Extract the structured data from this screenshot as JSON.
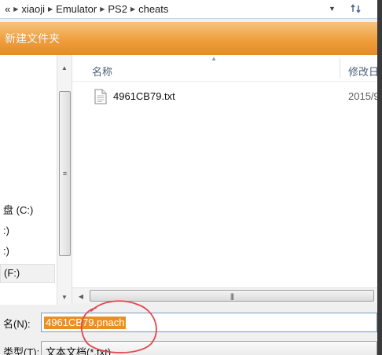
{
  "address": {
    "back_glyph": "«",
    "crumbs": [
      "xiaoji",
      "Emulator",
      "PS2",
      "cheats"
    ]
  },
  "toolbar": {
    "new_folder_label": "新建文件夹"
  },
  "nav": {
    "items": [
      "盘 (C:)",
      ":)",
      ":)",
      "(F:)"
    ]
  },
  "columns": {
    "name": "名称",
    "date_modified": "修改日"
  },
  "files": [
    {
      "name": "4961CB79.txt",
      "date": "2015/9",
      "icon": "text-file-icon"
    }
  ],
  "save": {
    "filename_label": "名(N):",
    "filename_value": "4961CB79.pnach",
    "filetype_label": "类型(T):",
    "filetype_value": "文本文档(*.txt)"
  },
  "colors": {
    "toolbar": "#ef9f3c",
    "selection": "#ec8f22",
    "annotation": "#e0474c"
  },
  "icons": {
    "refresh": "refresh-icon",
    "dropdown": "chevron-down-icon",
    "sort": "sort-up-icon"
  }
}
